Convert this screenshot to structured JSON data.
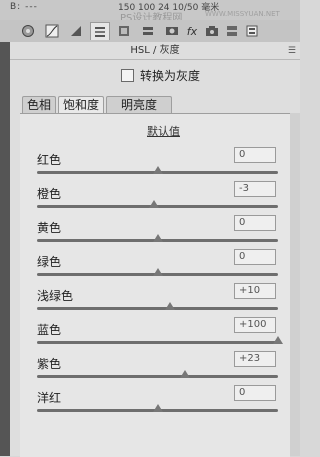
{
  "topbar": {
    "left_text": "B: ---",
    "mid_text": "150 100 24 10/50 毫米",
    "watermark": "PS设计教程网",
    "watermark_url": "WWW.MISSYUAN.NET"
  },
  "panel": {
    "title": "HSL / 灰度",
    "convert_to_gray_label": "转换为灰度",
    "convert_to_gray_checked": false,
    "tabs": [
      {
        "label": "色相",
        "active": false
      },
      {
        "label": "饱和度",
        "active": true
      },
      {
        "label": "明亮度",
        "active": false
      }
    ],
    "default_label": "默认值",
    "sliders": [
      {
        "label": "红色",
        "value": "0",
        "thumb_pct": 50
      },
      {
        "label": "橙色",
        "value": "-3",
        "thumb_pct": 48.5
      },
      {
        "label": "黄色",
        "value": "0",
        "thumb_pct": 50
      },
      {
        "label": "绿色",
        "value": "0",
        "thumb_pct": 50
      },
      {
        "label": "浅绿色",
        "value": "+10",
        "thumb_pct": 55
      },
      {
        "label": "蓝色",
        "value": "+100",
        "thumb_pct": 100
      },
      {
        "label": "紫色",
        "value": "+23",
        "thumb_pct": 61.5
      },
      {
        "label": "洋红",
        "value": "0",
        "thumb_pct": 50
      }
    ]
  },
  "tools": [
    "aperture-icon",
    "curve-icon",
    "triangle-icon",
    "lines-icon",
    "gray-icon",
    "stack-icon",
    "fx-icon",
    "camera-icon",
    "layers-icon",
    "sliders-icon"
  ]
}
